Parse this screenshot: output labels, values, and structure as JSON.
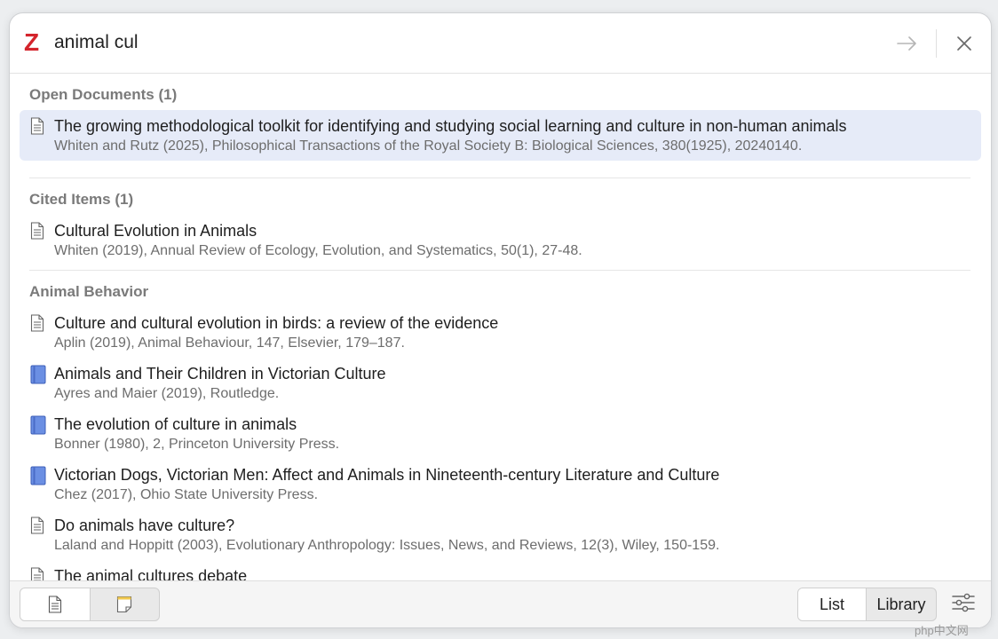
{
  "app": {
    "logo_letter": "Z",
    "brand_color": "#d4242c"
  },
  "search": {
    "value": "animal cul",
    "placeholder": ""
  },
  "sections": [
    {
      "header": "Open Documents (1)",
      "items": [
        {
          "type": "article",
          "title": "The growing methodological toolkit for identifying and studying social learning and culture in non-human animals",
          "meta": "Whiten and Rutz (2025), Philosophical Transactions of the Royal Society B: Biological Sciences, 380(1925), 20240140.",
          "selected": true
        }
      ]
    },
    {
      "header": "Cited Items (1)",
      "items": [
        {
          "type": "article",
          "title": "Cultural Evolution in Animals",
          "meta": "Whiten (2019), Annual Review of Ecology, Evolution, and Systematics, 50(1), 27-48."
        }
      ]
    },
    {
      "header": "Animal Behavior",
      "items": [
        {
          "type": "article",
          "title": "Culture and cultural evolution in birds: a review of the evidence",
          "meta": "Aplin (2019), Animal Behaviour, 147, Elsevier, 179–187."
        },
        {
          "type": "book",
          "title": "Animals and Their Children in Victorian Culture",
          "meta": "Ayres and Maier (2019), Routledge."
        },
        {
          "type": "book",
          "title": "The evolution of culture in animals",
          "meta": "Bonner (1980), 2, Princeton University Press."
        },
        {
          "type": "book",
          "title": "Victorian Dogs, Victorian Men: Affect and Animals in Nineteenth-century Literature and Culture",
          "meta": "Chez (2017), Ohio State University Press."
        },
        {
          "type": "article",
          "title": "Do animals have culture?",
          "meta": "Laland and Hoppitt (2003), Evolutionary Anthropology: Issues, News, and Reviews, 12(3), Wiley, 150-159."
        },
        {
          "type": "article",
          "title": "The animal cultures debate",
          "meta": ""
        }
      ]
    }
  ],
  "footer": {
    "view_toggle": {
      "left_icon": "document-icon",
      "right_icon": "note-icon"
    },
    "mode": {
      "list_label": "List",
      "library_label": "Library"
    },
    "settings_icon": "sliders-icon"
  },
  "watermark": "php中文网",
  "colors": {
    "selected_row": "#e6ebf8",
    "book_icon": "#5b7fd6",
    "section_header": "#7a7a7a"
  }
}
